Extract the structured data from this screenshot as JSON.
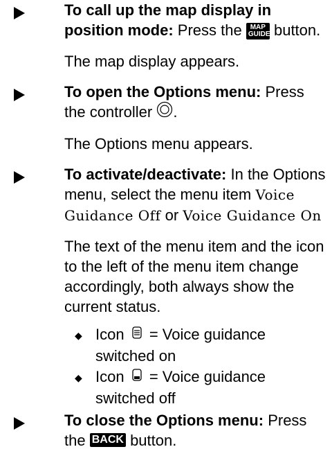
{
  "steps": [
    {
      "label": "To call up the map display in position mode:",
      "pre": "Press the",
      "button": "MAP GUIDE",
      "button_line1": "MAP",
      "button_line2": "GUIDE",
      "post": "button.",
      "result": "The map display appears."
    },
    {
      "label": "To open the Options menu:",
      "pre": "Press the controller",
      "result": "The Options menu appears."
    },
    {
      "label": "To activate/deactivate:",
      "pre": "In the Options menu, select the menu item",
      "item1": "Voice Guidance Off",
      "or": "or",
      "item2": "Voice Guidance On",
      "result": "The text of the menu item and the icon to the left of the menu item change accordingly, both always show the current status."
    },
    {
      "label": "To close the Options menu:",
      "pre": "Press the",
      "button": "BACK",
      "post": "button."
    }
  ],
  "bullets": [
    {
      "icon_word": "Icon",
      "icon": "speaker-on-icon",
      "text": "= Voice guidance switched on"
    },
    {
      "icon_word": "Icon",
      "icon": "speaker-off-icon",
      "text": "= Voice guidance switched off"
    }
  ]
}
